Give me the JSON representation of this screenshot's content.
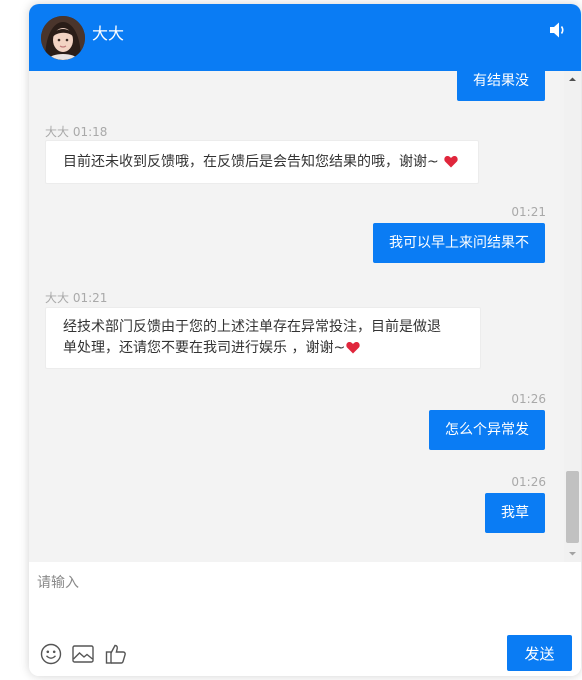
{
  "header": {
    "agent_name": "大大"
  },
  "messages": [
    {
      "side": "right",
      "time": "",
      "text": "有结果没"
    },
    {
      "side": "left",
      "sender": "大大",
      "time": "01:18",
      "text": "目前还未收到反馈哦，在反馈后是会告知您结果的哦，谢谢~"
    },
    {
      "side": "right",
      "time": "01:21",
      "text": "我可以早上来问结果不"
    },
    {
      "side": "left",
      "sender": "大大",
      "time": "01:21",
      "text_line1": "经技术部门反馈由于您的上述注单存在异常投注，目前是做退",
      "text_line2": "单处理，还请您不要在我司进行娱乐 ，谢谢~"
    },
    {
      "side": "right",
      "time": "01:26",
      "text": "怎么个异常发"
    },
    {
      "side": "right",
      "time": "01:26",
      "text": "我草"
    }
  ],
  "composer": {
    "placeholder": "请输入",
    "send_label": "发送"
  },
  "icons": {
    "speaker": "speaker-icon",
    "emoji": "emoji-icon",
    "image": "image-icon",
    "like": "thumbs-up-icon",
    "heart": "heart-icon"
  },
  "colors": {
    "accent": "#0a7cf4",
    "heart": "#e0263c",
    "chat_background": "#f3f3f3"
  }
}
